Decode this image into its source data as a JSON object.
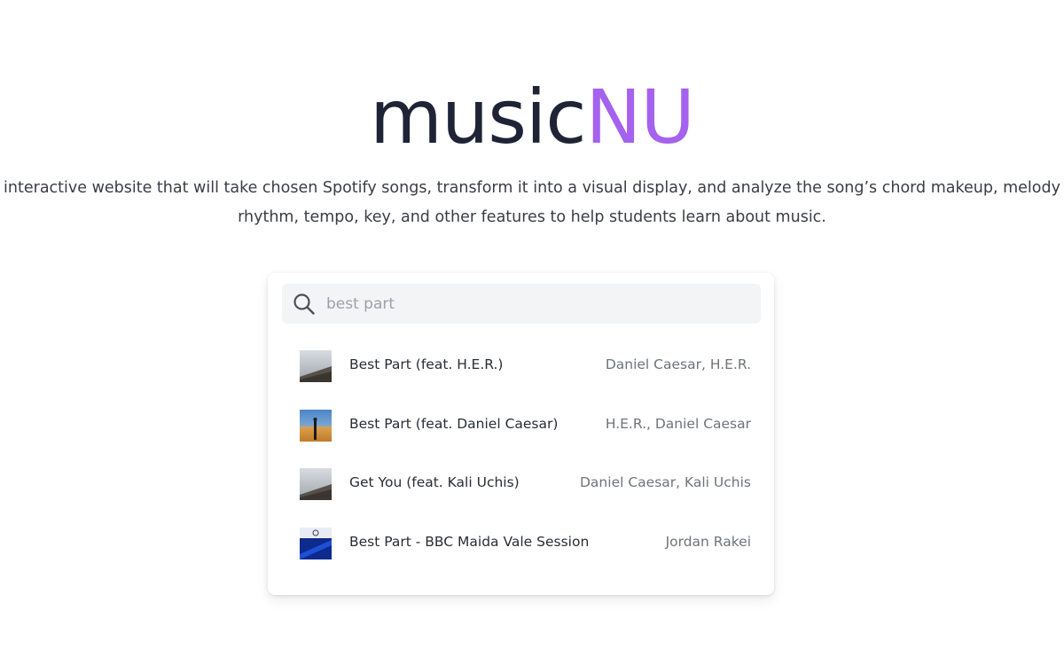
{
  "logo": {
    "part1": "music",
    "part2": "NU"
  },
  "tagline": {
    "line1": "interactive website that will take chosen Spotify songs, transform it into a visual display, and analyze the song’s chord makeup, melody",
    "line2": "rhythm, tempo, key, and other features to help students learn about music."
  },
  "search": {
    "value": "best part",
    "icon": "search-icon"
  },
  "results": [
    {
      "title": "Best Part (feat. H.E.R.)",
      "artist": "Daniel Caesar, H.E.R."
    },
    {
      "title": "Best Part (feat. Daniel Caesar)",
      "artist": "H.E.R., Daniel Caesar"
    },
    {
      "title": "Get You (feat. Kali Uchis)",
      "artist": "Daniel Caesar, Kali Uchis"
    },
    {
      "title": "Best Part - BBC Maida Vale Session",
      "artist": "Jordan Rakei"
    }
  ],
  "colors": {
    "brand_dark": "#1e2435",
    "brand_accent": "#a462ee"
  }
}
